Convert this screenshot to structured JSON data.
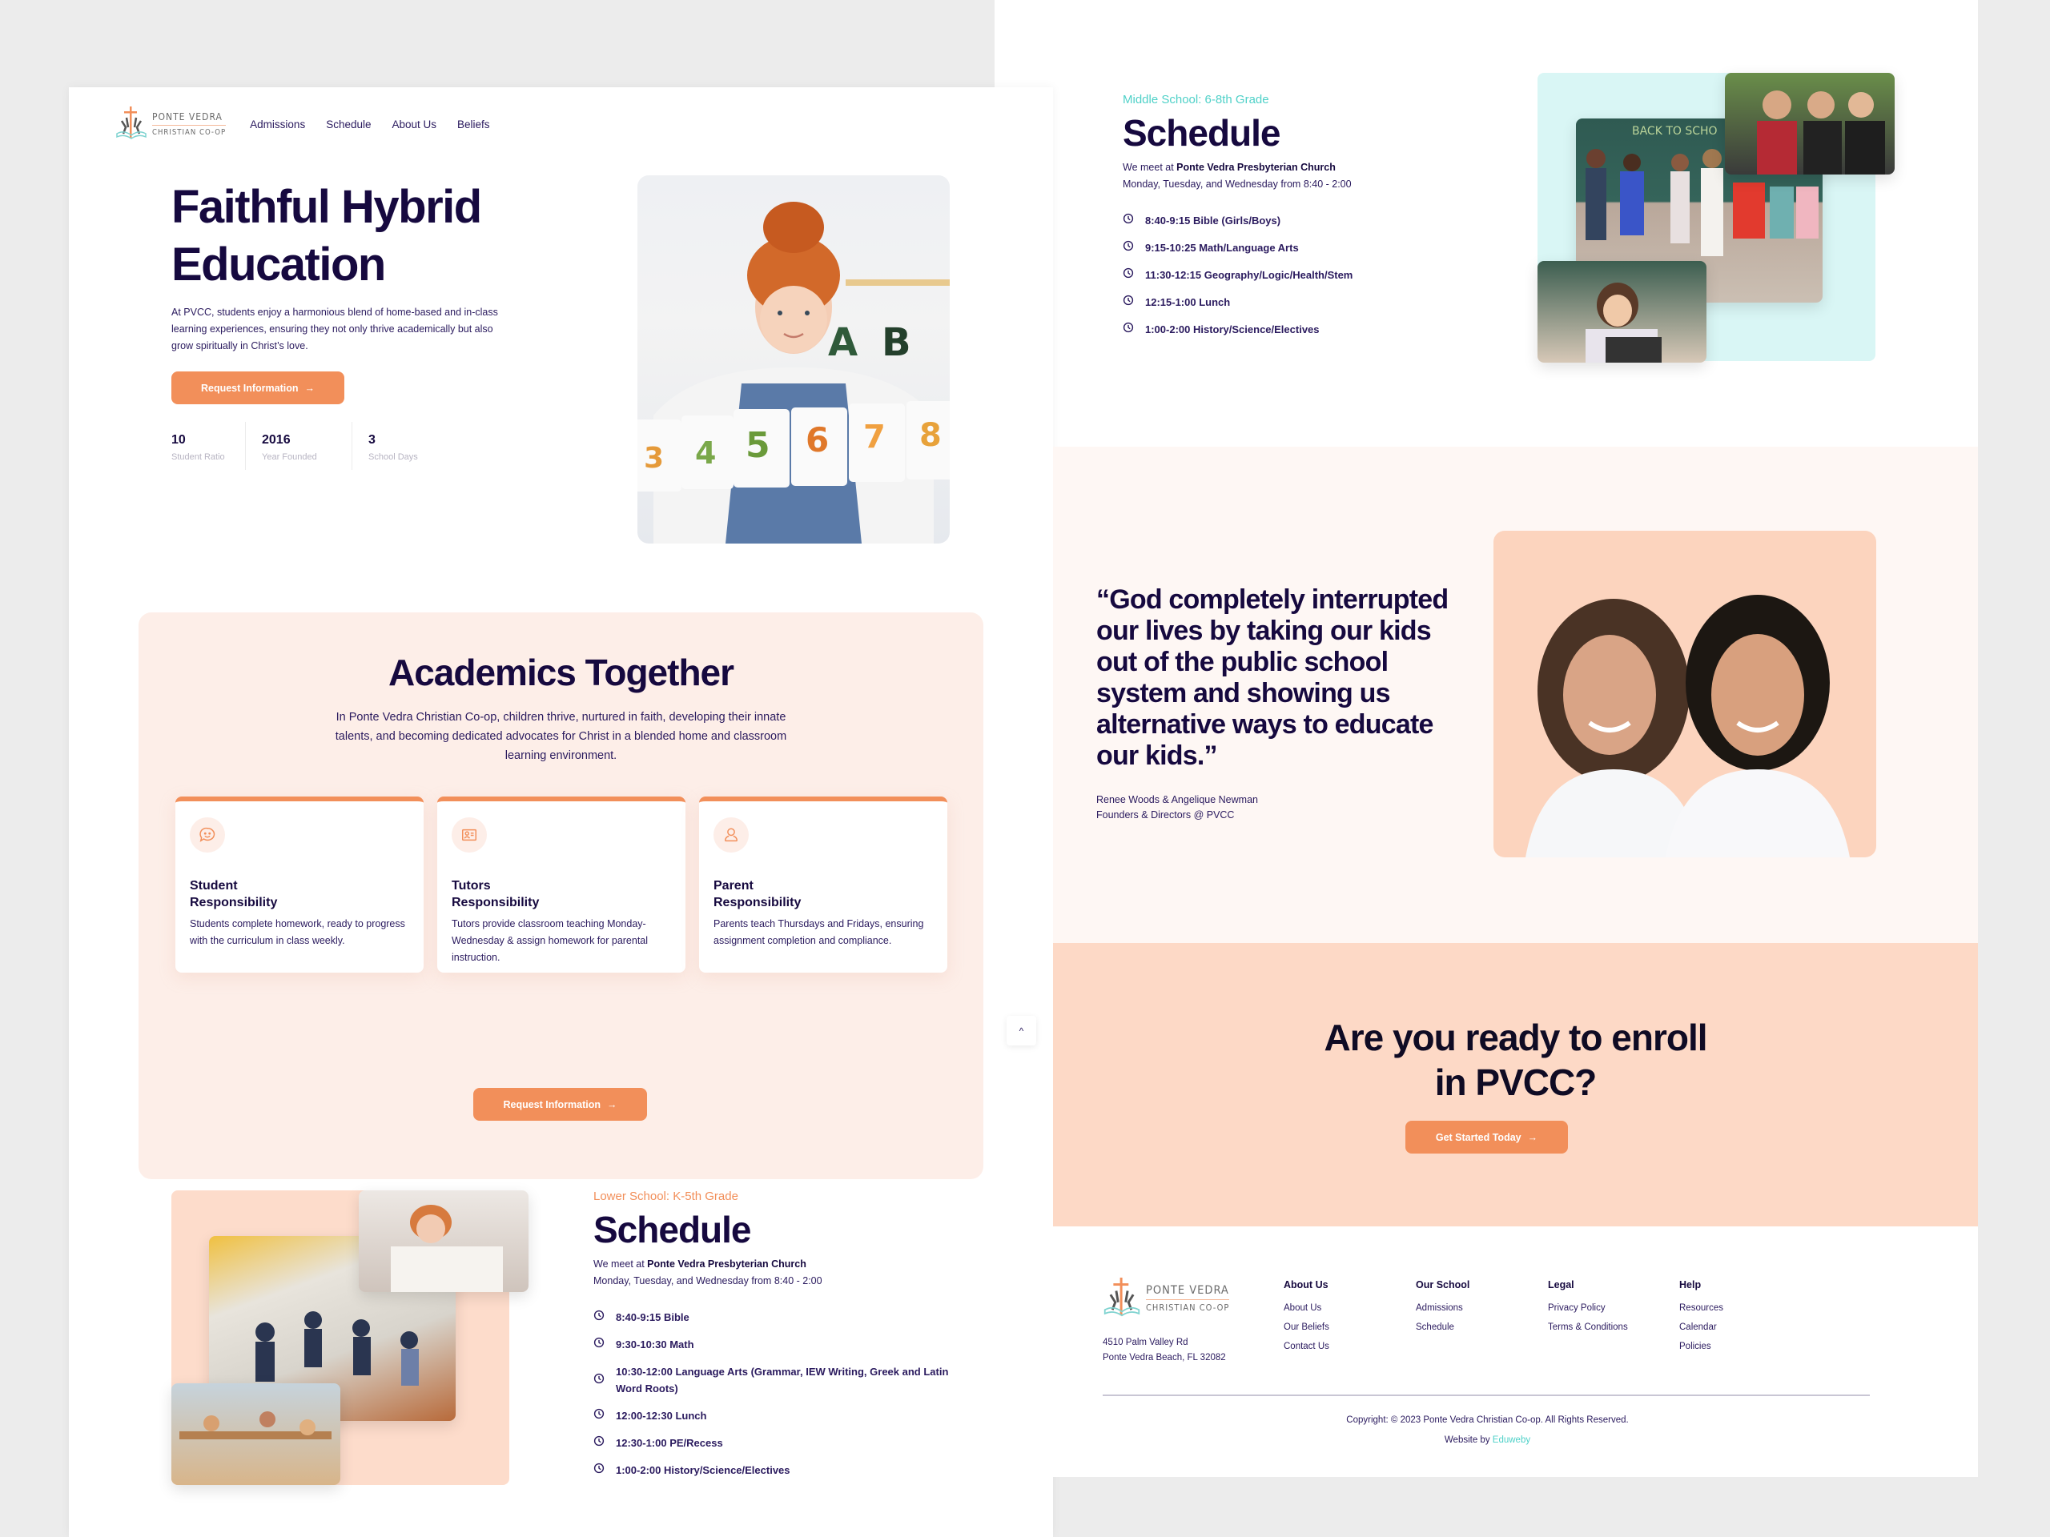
{
  "brand": {
    "line1": "PONTE VEDRA",
    "line2": "CHRISTIAN CO-OP",
    "colors": {
      "accent": "#f28f5a",
      "navy": "#16093f",
      "teal": "#4fd1c8",
      "peach": "#fdeee8"
    }
  },
  "nav": {
    "items": [
      {
        "label": "Admissions"
      },
      {
        "label": "Schedule"
      },
      {
        "label": "About Us"
      },
      {
        "label": "Beliefs"
      }
    ]
  },
  "hero": {
    "title_line1": "Faithful Hybrid",
    "title_line2": "Education",
    "description": "At PVCC, students enjoy a harmonious blend of home-based and in-class learning experiences, ensuring they not only thrive academically but also grow spiritually in Christ’s love.",
    "cta_label": "Request Information",
    "cta_icon": "arrow-right-icon",
    "stats": [
      {
        "value": "10",
        "label": "Student Ratio"
      },
      {
        "value": "2016",
        "label": "Year Founded"
      },
      {
        "value": "3",
        "label": "School Days"
      }
    ],
    "photo_alt": "Girl holding number cards"
  },
  "academics": {
    "title": "Academics Together",
    "description": "In Ponte Vedra Christian Co-op, children thrive, nurtured in faith, developing their innate talents, and becoming dedicated advocates for Christ in a blended home and classroom learning environment.",
    "cards": [
      {
        "icon": "chat-smile-icon",
        "title": "Student Responsibility",
        "description": "Students complete homework, ready to progress with the curriculum in class weekly."
      },
      {
        "icon": "id-card-icon",
        "title": "Tutors Responsibility",
        "description": "Tutors provide classroom teaching Monday-Wednesday & assign homework for parental instruction."
      },
      {
        "icon": "user-icon",
        "title": "Parent Responsibility",
        "description": "Parents teach Thursdays and Fridays, ensuring assignment completion and compliance."
      }
    ],
    "cta_label": "Request Information"
  },
  "scroll_top": {
    "icon": "chevron-up-icon",
    "glyph": "^"
  },
  "lower_school": {
    "kicker": "Lower School: K-5th Grade",
    "kicker_color": "#f28f5a",
    "title": "Schedule",
    "meet_prefix": "We meet at ",
    "meet_place": "Ponte Vedra Presbyterian Church",
    "days": "Monday, Tuesday, and Wednesday from 8:40 - 2:00",
    "items": [
      "8:40-9:15 Bible",
      "9:30-10:30 Math",
      "10:30-12:00 Language Arts (Grammar, IEW Writing, Greek and Latin Word Roots)",
      "12:00-12:30 Lunch",
      "12:30-1:00 PE/Recess",
      "1:00-2:00 History/Science/Electives"
    ]
  },
  "middle_school": {
    "kicker": "Middle School: 6-8th Grade",
    "kicker_color": "#4fd1c8",
    "title": "Schedule",
    "meet_prefix": "We meet at ",
    "meet_place": "Ponte Vedra Presbyterian Church",
    "days": "Monday, Tuesday, and Wednesday from 8:40 - 2:00",
    "items": [
      "8:40-9:15 Bible (Girls/Boys)",
      "9:15-10:25 Math/Language Arts",
      "11:30-12:15 Geography/Logic/Health/Stem",
      "12:15-1:00 Lunch",
      "1:00-2:00 History/Science/Electives"
    ]
  },
  "testimonial": {
    "quote": "“God completely interrupted our lives by taking our kids out of the public school system and showing us alternative ways to educate our kids.”",
    "author": "Renee Woods & Angelique Newman",
    "role": "Founders & Directors @ PVCC"
  },
  "cta": {
    "title_line1": "Are you ready to enroll",
    "title_line2": "in PVCC?",
    "button_label": "Get Started Today"
  },
  "footer": {
    "address_line1": "4510 Palm Valley Rd",
    "address_line2": "Ponte Vedra Beach, FL 32082",
    "columns": [
      {
        "heading": "About Us",
        "links": [
          "About Us",
          "Our Beliefs",
          "Contact Us"
        ]
      },
      {
        "heading": "Our School",
        "links": [
          "Admissions",
          "Schedule"
        ]
      },
      {
        "heading": "Legal",
        "links": [
          "Privacy Policy",
          "Terms & Conditions"
        ]
      },
      {
        "heading": "Help",
        "links": [
          "Resources",
          "Calendar",
          "Policies"
        ]
      }
    ],
    "copyright": "Copyright: © 2023 Ponte Vedra Christian Co-op. All Rights Reserved.",
    "website_by_prefix": "Website by ",
    "website_by_name": "Eduweby"
  }
}
